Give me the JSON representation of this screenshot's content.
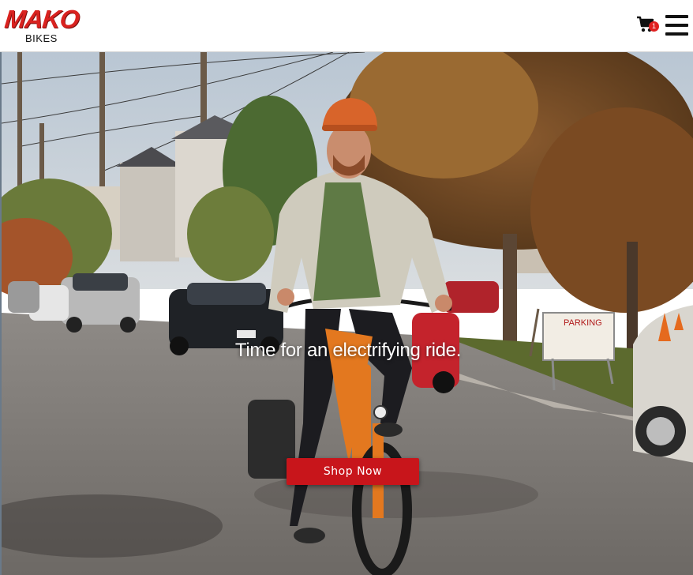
{
  "header": {
    "logo_text": "MAKO",
    "logo_subtext": "BIKES",
    "cart_icon": "cart-icon",
    "cart_count": "1",
    "menu_icon": "hamburger-menu-icon"
  },
  "hero": {
    "tagline": "Time for an electrifying ride.",
    "cta_label": "Shop Now",
    "sign_text": "PARKING",
    "colors": {
      "cta": "#c8151b",
      "brand": "#d9221f"
    }
  }
}
